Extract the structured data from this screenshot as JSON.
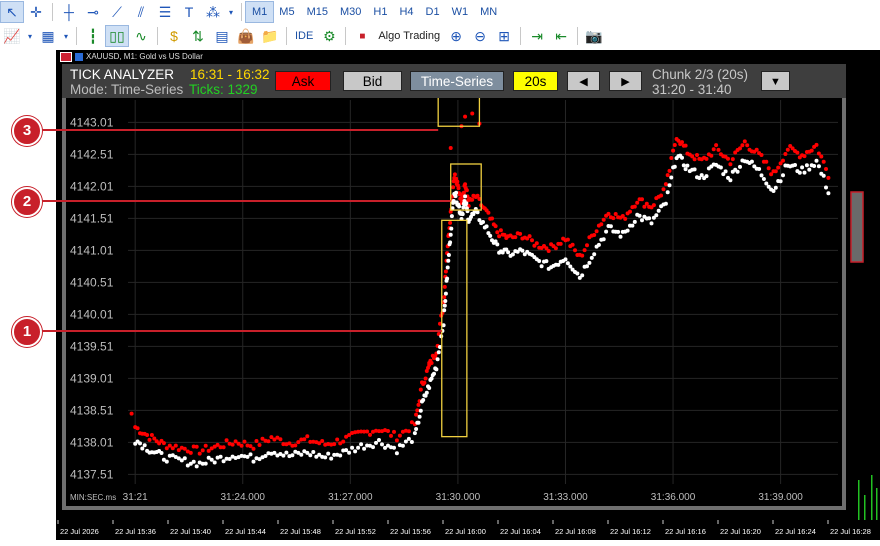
{
  "toolbar": {
    "timeframes": [
      "M1",
      "M5",
      "M15",
      "M30",
      "H1",
      "H4",
      "D1",
      "W1",
      "MN"
    ],
    "selected_timeframe": "M1",
    "ide_label": "IDE",
    "algo_label": "Algo Trading"
  },
  "window": {
    "title": "XAUUSD, M1:  Gold vs US Dollar"
  },
  "analyzer": {
    "title": "TICK ANALYZER",
    "time_range": "16:31 - 16:32",
    "mode_label": "Mode: Time-Series",
    "ticks_label": "Ticks: 1329",
    "ask_label": "Ask",
    "bid_label": "Bid",
    "series_label": "Time-Series",
    "interval_label": "20s",
    "prev_label": "◀",
    "next_label": "▶",
    "chunk_label": "Chunk 2/3 (20s)",
    "chunk_range": "31:20 - 31:40",
    "dropdown_label": "▼",
    "axis_unit": "MIN:SEC.ms"
  },
  "colors": {
    "ask": "#ff0000",
    "bid": "#ffffff",
    "highlight": "#f0d040",
    "annotation": "#c8202a"
  },
  "annotations": [
    "1",
    "2",
    "3"
  ],
  "date_labels": [
    "22 Jul 2026",
    "22 Jul 15:36",
    "22 Jul 15:40",
    "22 Jul 15:44",
    "22 Jul 15:48",
    "22 Jul 15:52",
    "22 Jul 15:56",
    "22 Jul 16:00",
    "22 Jul 16:04",
    "22 Jul 16:08",
    "22 Jul 16:12",
    "22 Jul 16:16",
    "22 Jul 16:20",
    "22 Jul 16:24",
    "22 Jul 16:28"
  ],
  "chart_data": {
    "type": "scatter",
    "xlabel": "MIN:SEC.ms",
    "ylim": [
      4137.36,
      4143.36
    ],
    "xlim": [
      20.8,
      40.6
    ],
    "y_ticks": [
      "4137.51",
      "4138.01",
      "4138.51",
      "4139.01",
      "4139.51",
      "4140.01",
      "4140.51",
      "4141.01",
      "4141.51",
      "4142.01",
      "4142.51",
      "4143.01"
    ],
    "y_tick_values": [
      4137.51,
      4138.01,
      4138.51,
      4139.01,
      4139.51,
      4140.01,
      4140.51,
      4141.01,
      4141.51,
      4142.01,
      4142.51,
      4143.01
    ],
    "x_ticks": [
      "31:21",
      "31:24.000",
      "31:27.000",
      "31:30.000",
      "31:33.000",
      "31:36.000",
      "31:39.000"
    ],
    "x_tick_values": [
      21,
      24,
      27,
      30,
      33,
      36,
      39
    ],
    "series": [
      {
        "name": "Ask",
        "color": "#ff0000",
        "x": [
          21.0,
          21.4,
          21.8,
          22.3,
          22.8,
          23.3,
          23.8,
          24.3,
          24.8,
          25.3,
          25.8,
          26.3,
          26.8,
          27.3,
          27.8,
          28.3,
          28.8,
          29.0,
          29.2,
          29.4,
          29.6,
          29.7,
          29.8,
          29.9,
          30.0,
          30.1,
          30.2,
          30.3,
          30.5,
          30.8,
          31.1,
          31.4,
          31.8,
          32.2,
          32.6,
          33.0,
          33.4,
          33.8,
          34.2,
          34.6,
          35.0,
          35.4,
          35.8,
          36.1,
          36.4,
          36.8,
          37.2,
          37.6,
          38.0,
          38.4,
          38.8,
          39.2,
          39.6,
          40.0,
          40.4
        ],
        "y": [
          4138.25,
          4138.1,
          4137.98,
          4137.92,
          4137.88,
          4137.95,
          4138.02,
          4137.96,
          4138.08,
          4138.0,
          4138.05,
          4137.98,
          4138.05,
          4138.15,
          4138.22,
          4138.1,
          4138.3,
          4138.9,
          4139.2,
          4139.45,
          4140.2,
          4141.0,
          4141.6,
          4142.2,
          4142.0,
          4141.8,
          4142.05,
          4141.75,
          4141.85,
          4141.6,
          4141.3,
          4141.2,
          4141.25,
          4141.1,
          4141.05,
          4141.2,
          4140.9,
          4141.3,
          4141.6,
          4141.5,
          4141.8,
          4141.7,
          4142.0,
          4142.8,
          4142.55,
          4142.4,
          4142.6,
          4142.4,
          4142.7,
          4142.5,
          4142.2,
          4142.6,
          4142.5,
          4142.65,
          4142.1
        ],
        "outliers_x": [
          20.9,
          29.2,
          29.8,
          30.1,
          30.2,
          30.4,
          30.6
        ],
        "outliers_y": [
          4138.46,
          4139.25,
          4142.61,
          4142.95,
          4143.1,
          4143.15,
          4142.99
        ]
      },
      {
        "name": "Bid",
        "color": "#ffffff",
        "x": [
          21.0,
          21.4,
          21.8,
          22.3,
          22.8,
          23.3,
          23.8,
          24.3,
          24.8,
          25.3,
          25.8,
          26.3,
          26.8,
          27.3,
          27.8,
          28.3,
          28.8,
          29.0,
          29.2,
          29.4,
          29.6,
          29.7,
          29.8,
          29.9,
          30.0,
          30.1,
          30.2,
          30.3,
          30.5,
          30.8,
          31.1,
          31.4,
          31.8,
          32.2,
          32.6,
          33.0,
          33.4,
          33.8,
          34.2,
          34.6,
          35.0,
          35.4,
          35.8,
          36.1,
          36.4,
          36.8,
          37.2,
          37.6,
          38.0,
          38.4,
          38.8,
          39.2,
          39.6,
          40.0,
          40.4
        ],
        "y": [
          4138.05,
          4137.9,
          4137.78,
          4137.72,
          4137.68,
          4137.75,
          4137.82,
          4137.76,
          4137.88,
          4137.8,
          4137.85,
          4137.78,
          4137.85,
          4137.95,
          4138.02,
          4137.9,
          4138.1,
          4138.6,
          4138.9,
          4139.2,
          4139.9,
          4140.6,
          4141.3,
          4141.95,
          4141.75,
          4141.55,
          4141.8,
          4141.5,
          4141.6,
          4141.35,
          4141.05,
          4140.95,
          4141.0,
          4140.85,
          4140.75,
          4140.9,
          4140.6,
          4141.0,
          4141.35,
          4141.25,
          4141.55,
          4141.45,
          4141.75,
          4142.5,
          4142.3,
          4142.15,
          4142.35,
          4142.15,
          4142.45,
          4142.25,
          4141.95,
          4142.35,
          4142.25,
          4142.4,
          4141.85
        ]
      }
    ],
    "highlight_boxes": [
      {
        "label": "1",
        "x0": 29.55,
        "x1": 30.25,
        "y0": 4138.1,
        "y1": 4141.48
      },
      {
        "label": "2",
        "x0": 29.8,
        "x1": 30.65,
        "y0": 4141.64,
        "y1": 4142.36
      },
      {
        "label": "3",
        "x0": 29.45,
        "x1": 30.6,
        "y0": 4142.95,
        "y1": 4143.5
      }
    ]
  }
}
